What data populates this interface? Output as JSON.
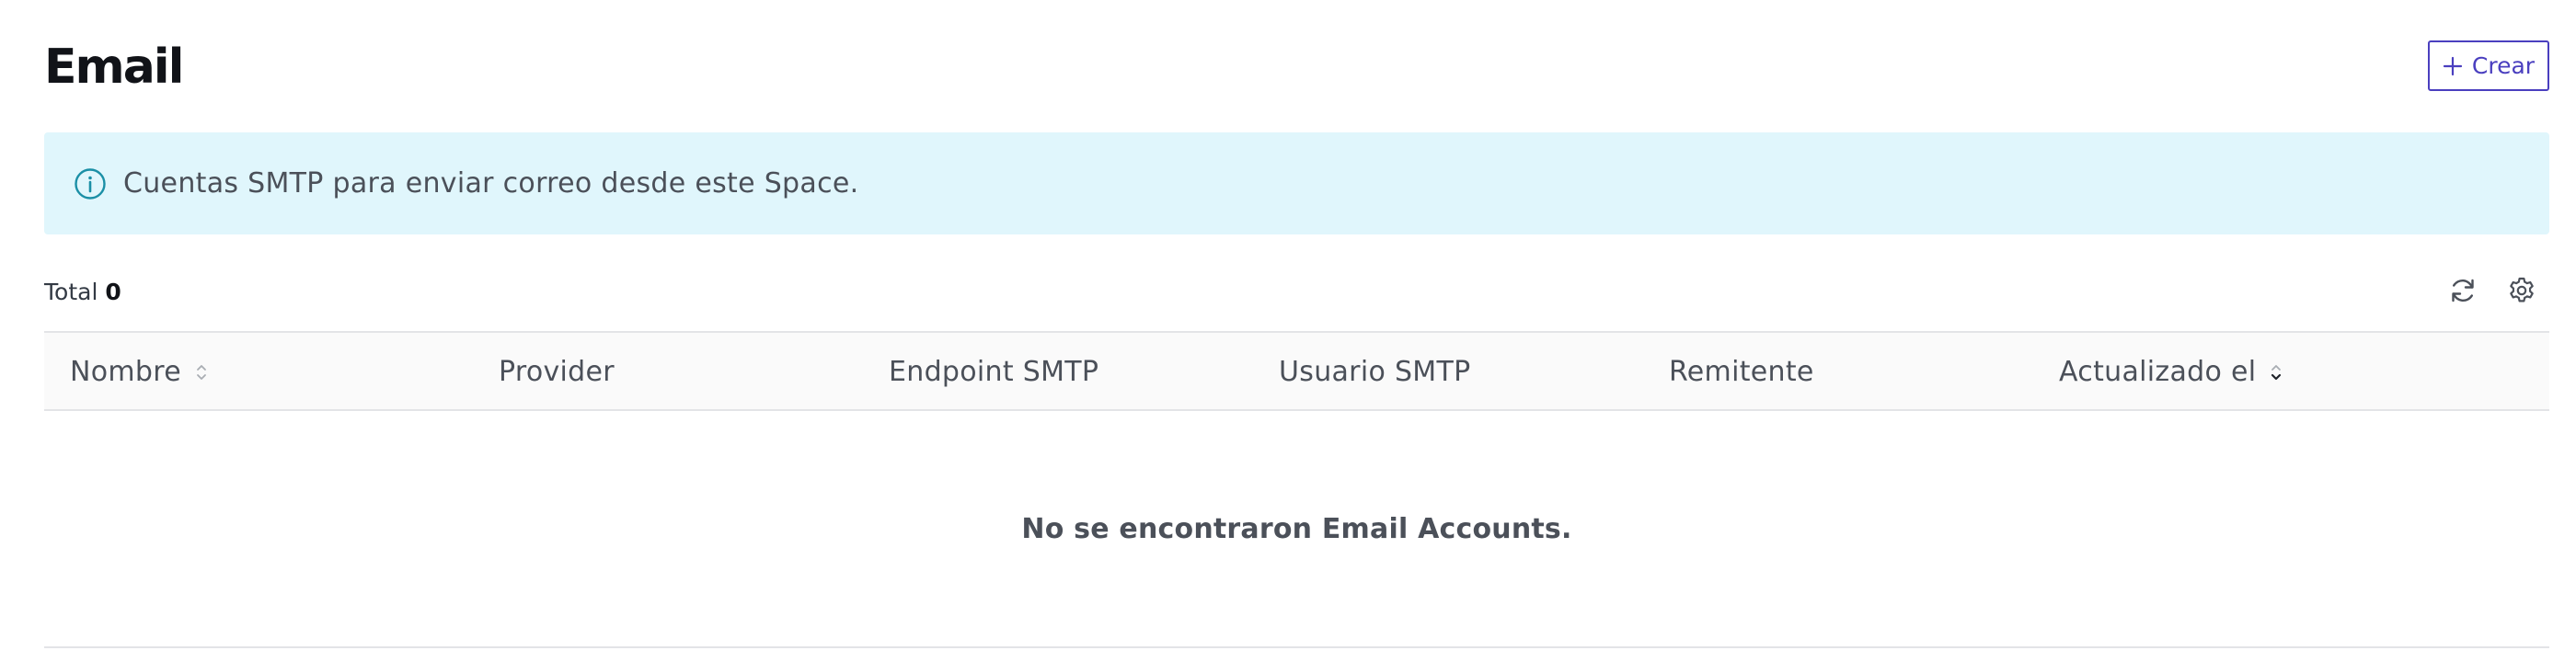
{
  "header": {
    "title": "Email",
    "create_button": {
      "label": "Crear",
      "icon": "plus-icon"
    }
  },
  "info_banner": {
    "icon": "info-circle-icon",
    "text": "Cuentas SMTP para enviar correo desde este Space."
  },
  "summary": {
    "total_label": "Total",
    "total_value": "0"
  },
  "toolbar": {
    "refresh_icon": "refresh-icon",
    "settings_icon": "gear-icon"
  },
  "table": {
    "columns": [
      {
        "label": "Nombre",
        "sort": "sortable"
      },
      {
        "label": "Provider",
        "sort": "none"
      },
      {
        "label": "Endpoint SMTP",
        "sort": "none"
      },
      {
        "label": "Usuario SMTP",
        "sort": "none"
      },
      {
        "label": "Remitente",
        "sort": "none"
      },
      {
        "label": "Actualizado el",
        "sort": "descending"
      }
    ],
    "rows": [],
    "empty_text": "No se encontraron Email Accounts."
  },
  "colors": {
    "accent": "#4a3fbf",
    "banner_background": "#e0f6fc",
    "info_icon": "#1a8fa6",
    "header_background": "#fafafa",
    "border": "#e3e4e7",
    "text_muted": "#4b5059"
  }
}
